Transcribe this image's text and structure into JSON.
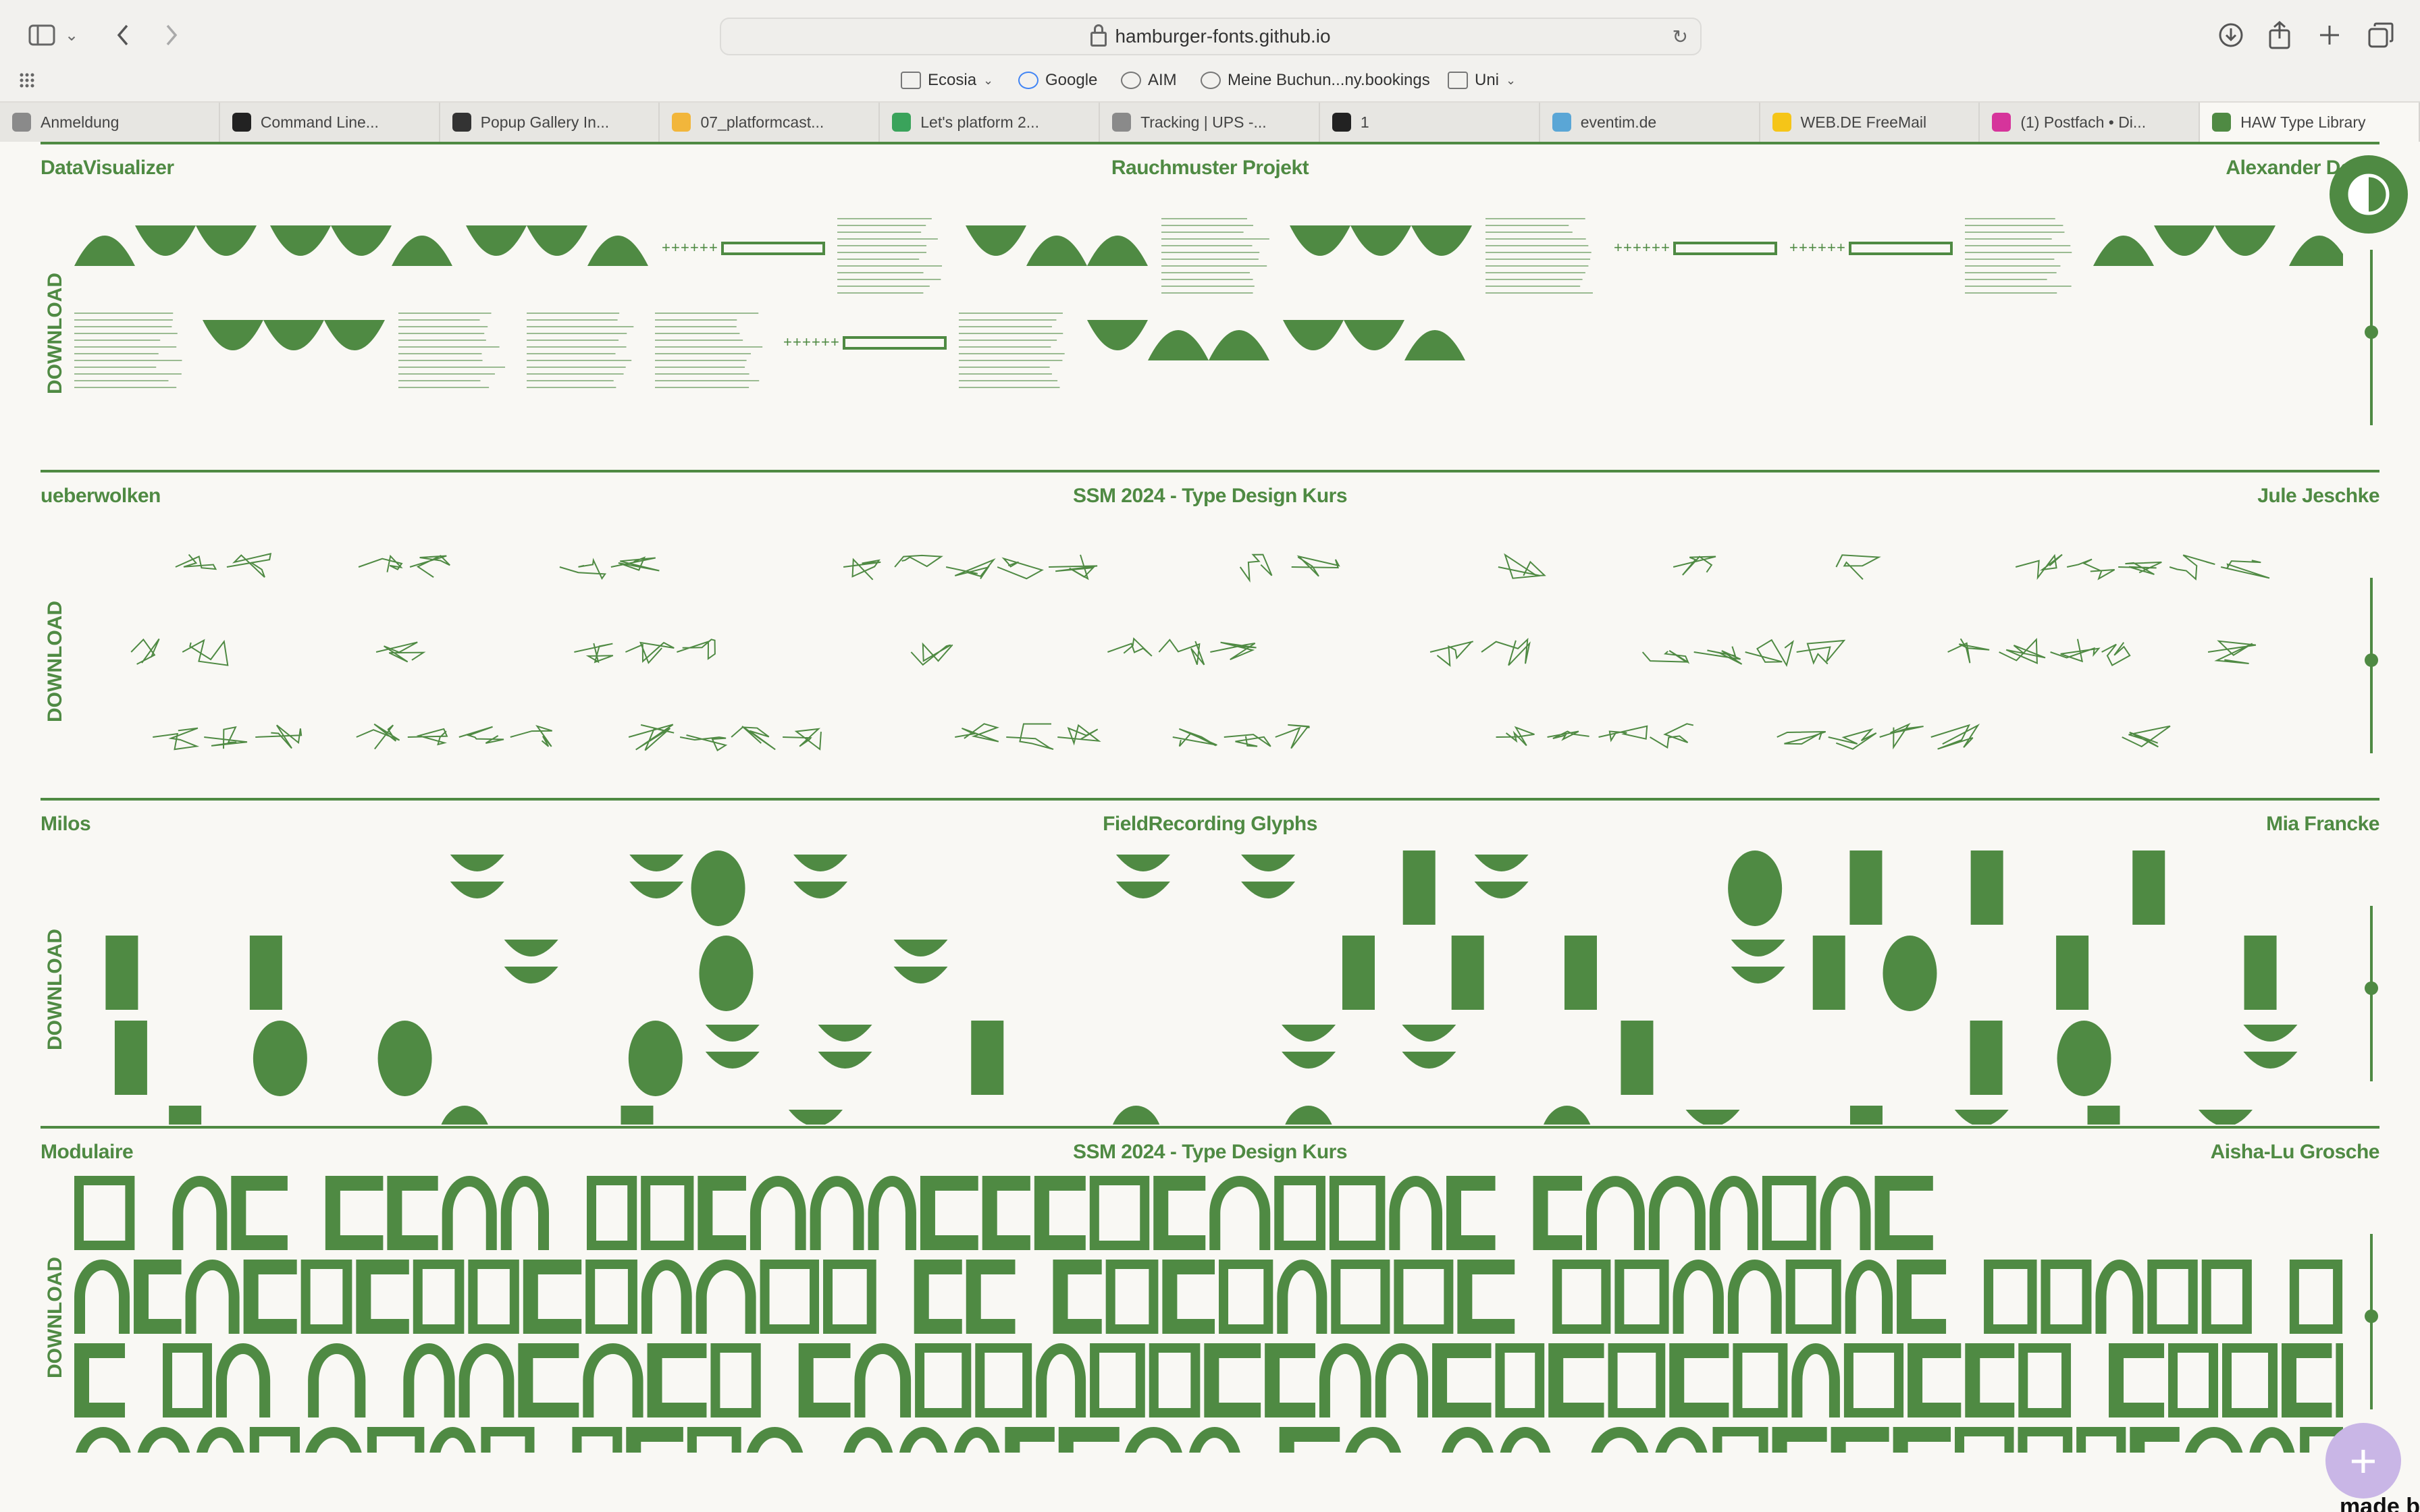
{
  "browser": {
    "url": "hamburger-fonts.github.io",
    "bookmarks": [
      {
        "label": "Ecosia",
        "icon": "folder-icon",
        "dropdown": true
      },
      {
        "label": "Google",
        "icon": "google-icon",
        "dropdown": false
      },
      {
        "label": "AIM",
        "icon": "globe-icon",
        "dropdown": false
      },
      {
        "label": "Meine Buchun...ny.bookings",
        "icon": "globe-icon",
        "dropdown": false
      },
      {
        "label": "Uni",
        "icon": "folder-icon",
        "dropdown": true
      }
    ],
    "tabs": [
      {
        "label": "Anmeldung",
        "color": "#8a8a8a"
      },
      {
        "label": "Command Line...",
        "color": "#222222"
      },
      {
        "label": "Popup Gallery In...",
        "color": "#333333"
      },
      {
        "label": "07_platformcast...",
        "color": "#f2b63b"
      },
      {
        "label": "Let's platform 2...",
        "color": "#3aa35b"
      },
      {
        "label": "Tracking | UPS -...",
        "color": "#8a8a8a"
      },
      {
        "label": "1",
        "color": "#222222"
      },
      {
        "label": "eventim.de",
        "color": "#5aa6d6"
      },
      {
        "label": "WEB.DE FreeMail",
        "color": "#f5c518"
      },
      {
        "label": "(1) Postfach • Di...",
        "color": "#d6349b"
      },
      {
        "label": "HAW Type Library",
        "color": "#4f8a43"
      }
    ]
  },
  "page": {
    "download_label": "DOWNLOAD",
    "fonts": [
      {
        "name": "DataVisualizer",
        "course": "Rauchmuster Projekt",
        "author": "Alexander Delap",
        "style": "data"
      },
      {
        "name": "ueberwolken",
        "course": "SSM 2024 - Type Design Kurs",
        "author": "Jule Jeschke",
        "style": "sketch"
      },
      {
        "name": "Milos",
        "course": "FieldRecording Glyphs",
        "author": "Mia Francke",
        "style": "blob"
      },
      {
        "name": "Modulaire",
        "course": "SSM 2024 - Type Design Kurs",
        "author": "Aisha-Lu Grosche",
        "style": "modular"
      }
    ],
    "made_by": "made b",
    "accent": "#4f8a43",
    "add_button_color": "#c9b6e6"
  }
}
